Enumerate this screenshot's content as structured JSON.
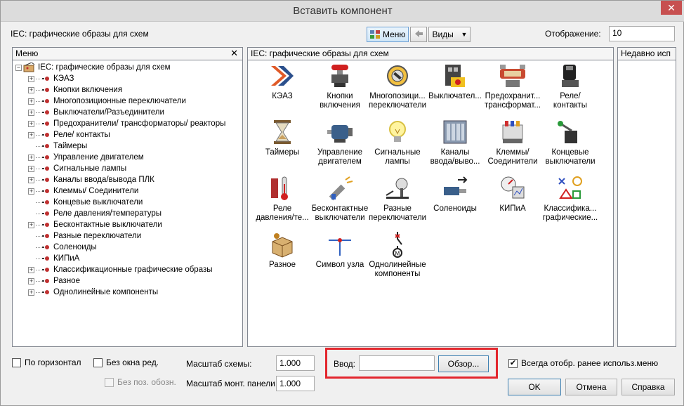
{
  "window": {
    "title": "Вставить компонент",
    "close_glyph": "✕"
  },
  "header": {
    "library_label": "IEC: графические образы для схем",
    "menu_button": "Меню",
    "views_button": "Виды",
    "display_label": "Отображение:",
    "display_value": "10"
  },
  "left_panel": {
    "title": "Меню",
    "close_glyph": "✕",
    "tree_root": "IEC: графические образы для схем",
    "tree_items": [
      {
        "label": "КЭАЗ",
        "expandable": true
      },
      {
        "label": "Кнопки включения",
        "expandable": true
      },
      {
        "label": "Многопозиционные переключатели",
        "expandable": true
      },
      {
        "label": "Выключатели/Разъединители",
        "expandable": true
      },
      {
        "label": "Предохранители/ трансформаторы/ реакторы",
        "expandable": true
      },
      {
        "label": "Реле/ контакты",
        "expandable": true
      },
      {
        "label": "Таймеры",
        "expandable": false
      },
      {
        "label": "Управление двигателем",
        "expandable": true
      },
      {
        "label": "Сигнальные лампы",
        "expandable": true
      },
      {
        "label": "Каналы ввода/вывода ПЛК",
        "expandable": true
      },
      {
        "label": "Клеммы/ Соединители",
        "expandable": true
      },
      {
        "label": "Концевые выключатели",
        "expandable": false
      },
      {
        "label": "Реле давления/температуры",
        "expandable": false
      },
      {
        "label": "Бесконтактные выключатели",
        "expandable": true
      },
      {
        "label": "Разные переключатели",
        "expandable": false
      },
      {
        "label": "Соленоиды",
        "expandable": false
      },
      {
        "label": "КИПиА",
        "expandable": false
      },
      {
        "label": "Классификационные графические образы",
        "expandable": true
      },
      {
        "label": "Разное",
        "expandable": true
      },
      {
        "label": "Однолинейные компоненты",
        "expandable": true
      }
    ]
  },
  "center_panel": {
    "title": "IEC: графические образы для схем",
    "icons": [
      {
        "line1": "КЭАЗ",
        "line2": "",
        "icon": "keaz-logo-icon"
      },
      {
        "line1": "Кнопки",
        "line2": "включения",
        "icon": "push-button-icon"
      },
      {
        "line1": "Многопозици...",
        "line2": "переключатели",
        "icon": "selector-switch-icon"
      },
      {
        "line1": "Выключател...",
        "line2": "",
        "icon": "disconnect-switch-icon"
      },
      {
        "line1": "Предохранит...",
        "line2": "трансформат...",
        "icon": "fuse-transformer-icon"
      },
      {
        "line1": "Реле/",
        "line2": "контакты",
        "icon": "relay-icon"
      },
      {
        "line1": "Таймеры",
        "line2": "",
        "icon": "hourglass-icon"
      },
      {
        "line1": "Управление",
        "line2": "двигателем",
        "icon": "motor-icon"
      },
      {
        "line1": "Сигнальные",
        "line2": "лампы",
        "icon": "lamp-icon"
      },
      {
        "line1": "Каналы",
        "line2": "ввода/выво...",
        "icon": "plc-io-icon"
      },
      {
        "line1": "Клеммы/",
        "line2": "Соединители",
        "icon": "terminal-icon"
      },
      {
        "line1": "Концевые",
        "line2": "выключатели",
        "icon": "limit-switch-icon"
      },
      {
        "line1": "Реле",
        "line2": "давления/те...",
        "icon": "pressure-temp-icon"
      },
      {
        "line1": "Бесконтактные",
        "line2": "выключатели",
        "icon": "proximity-switch-icon"
      },
      {
        "line1": "Разные",
        "line2": "переключатели",
        "icon": "misc-switch-icon"
      },
      {
        "line1": "Соленоиды",
        "line2": "",
        "icon": "solenoid-icon"
      },
      {
        "line1": "КИПиА",
        "line2": "",
        "icon": "instrument-icon"
      },
      {
        "line1": "Классифика...",
        "line2": "графические...",
        "icon": "classification-icon"
      },
      {
        "line1": "Разное",
        "line2": "",
        "icon": "misc-box-icon"
      },
      {
        "line1": "Символ узла",
        "line2": "",
        "icon": "node-symbol-icon"
      },
      {
        "line1": "Однолинейные",
        "line2": "компоненты",
        "icon": "one-line-icon"
      }
    ]
  },
  "right_panel": {
    "title": "Недавно исп"
  },
  "bottom": {
    "horizontal_label": "По горизонтал",
    "no_edit_window_label": "Без окна ред.",
    "no_pos_label": "Без поз. обозн.",
    "scheme_scale_label": "Масштаб схемы:",
    "scheme_scale_value": "1.000",
    "panel_scale_label": "Масштаб монт. панели:",
    "panel_scale_value": "1.000",
    "input_label": "Ввод:",
    "input_value": "",
    "browse_button": "Обзор...",
    "always_show_label": "Всегда отобр. ранее использ.меню",
    "ok_button": "OK",
    "cancel_button": "Отмена",
    "help_button": "Справка"
  },
  "colors": {
    "highlight_box": "#e3262d",
    "accent": "#3c7fb1"
  }
}
